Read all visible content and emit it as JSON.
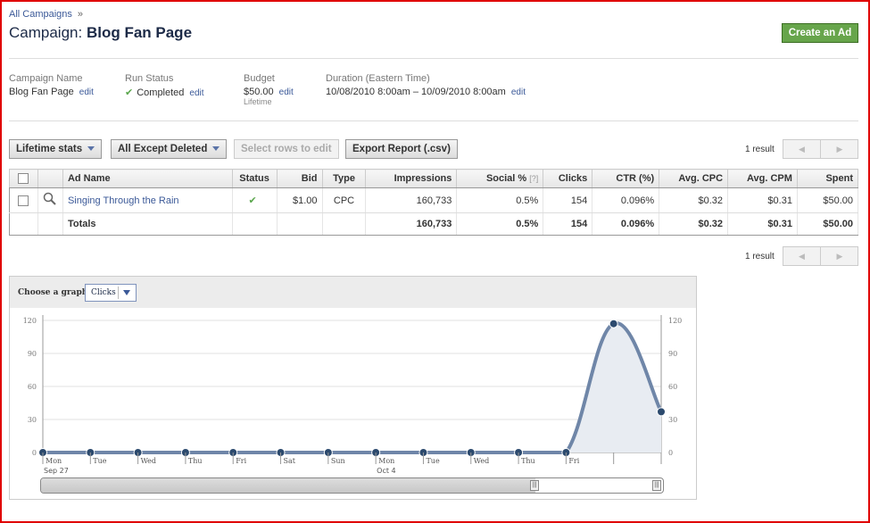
{
  "breadcrumb": {
    "link": "All Campaigns",
    "sep": "»"
  },
  "header": {
    "prefix": "Campaign:",
    "name": "Blog Fan Page",
    "create_label": "Create an Ad"
  },
  "info": {
    "campaign_name": {
      "label": "Campaign Name",
      "value": "Blog Fan Page",
      "edit": "edit"
    },
    "run_status": {
      "label": "Run Status",
      "value": "Completed",
      "edit": "edit"
    },
    "budget": {
      "label": "Budget",
      "value": "$50.00",
      "edit": "edit",
      "sub": "Lifetime"
    },
    "duration": {
      "label": "Duration (Eastern Time)",
      "value": "10/08/2010 8:00am – 10/09/2010 8:00am",
      "edit": "edit"
    }
  },
  "toolbar": {
    "stats_label": "Lifetime stats",
    "filter_label": "All Except Deleted",
    "select_rows_label": "Select rows to edit",
    "export_label": "Export Report (.csv)",
    "result_count": "1 result"
  },
  "table": {
    "headers": {
      "ad_name": "Ad Name",
      "status": "Status",
      "bid": "Bid",
      "type": "Type",
      "impressions": "Impressions",
      "social": "Social %",
      "social_help": "[?]",
      "clicks": "Clicks",
      "ctr": "CTR (%)",
      "avg_cpc": "Avg. CPC",
      "avg_cpm": "Avg. CPM",
      "spent": "Spent"
    },
    "row": {
      "ad_name": "Singing Through the Rain",
      "bid": "$1.00",
      "type": "CPC",
      "impressions": "160,733",
      "social": "0.5%",
      "clicks": "154",
      "ctr": "0.096%",
      "avg_cpc": "$0.32",
      "avg_cpm": "$0.31",
      "spent": "$50.00"
    },
    "totals": {
      "label": "Totals",
      "impressions": "160,733",
      "social": "0.5%",
      "clicks": "154",
      "ctr": "0.096%",
      "avg_cpc": "$0.32",
      "avg_cpm": "$0.31",
      "spent": "$50.00"
    }
  },
  "graph": {
    "choose_label": "Choose a graph:",
    "selected": "Clicks"
  },
  "chart_data": {
    "type": "area",
    "ylim": [
      0,
      120
    ],
    "yticks": [
      0,
      30,
      60,
      90,
      120
    ],
    "x": [
      "Mon",
      "Tue",
      "Wed",
      "Thu",
      "Fri",
      "Sat",
      "Sun",
      "Mon",
      "Tue",
      "Wed",
      "Thu",
      "Fri"
    ],
    "x_sublabels": [
      "Sep 27",
      "",
      "",
      "",
      "",
      "",
      "",
      "Oct 4",
      "",
      "",
      "",
      ""
    ],
    "series": [
      {
        "values": [
          0,
          0,
          0,
          0,
          0,
          0,
          0,
          0,
          0,
          0,
          0,
          0,
          117,
          37
        ]
      }
    ],
    "grid": true,
    "colors": {
      "line": "#6f86a8",
      "fill": "#e8ecf2",
      "point": "#2c4a6e"
    }
  }
}
